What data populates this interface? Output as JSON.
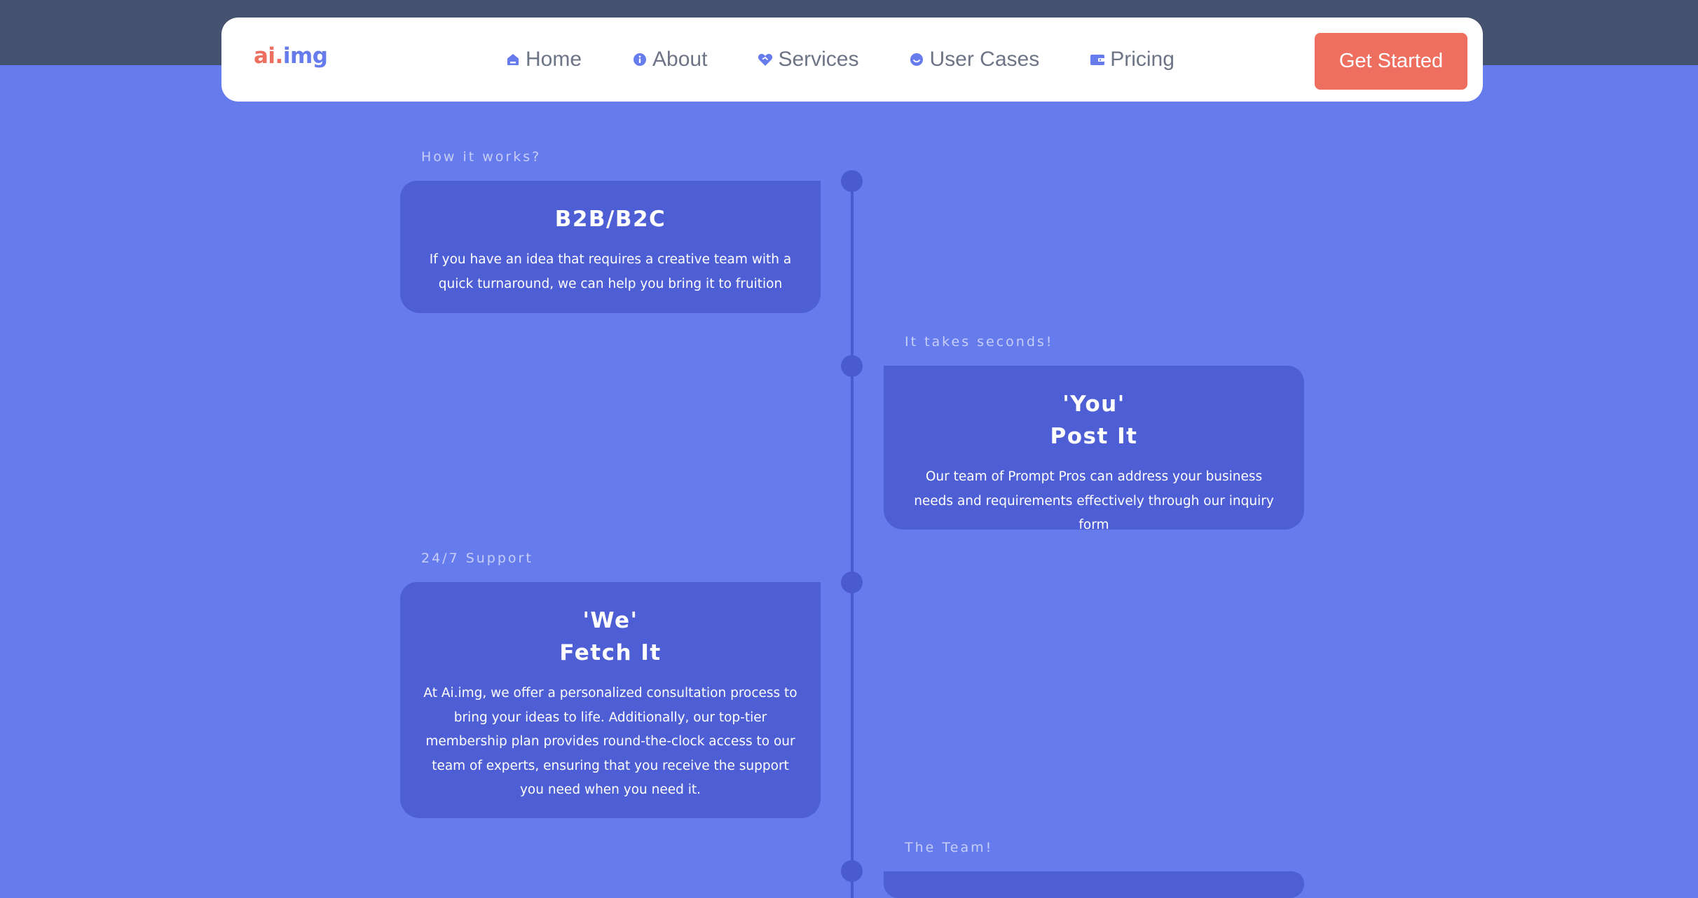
{
  "brand": {
    "part1": "ai",
    "dot": ".",
    "part2": "img"
  },
  "nav": {
    "items": [
      {
        "label": "Home",
        "icon": "home-icon"
      },
      {
        "label": "About",
        "icon": "info-icon"
      },
      {
        "label": "Services",
        "icon": "heart-handshake-icon"
      },
      {
        "label": "User Cases",
        "icon": "smile-icon"
      },
      {
        "label": "Pricing",
        "icon": "wallet-icon"
      }
    ],
    "cta_label": "Get Started"
  },
  "timeline": [
    {
      "label": "How it works?",
      "title_line1": "B2B/B2C",
      "title_line2": "",
      "description": "If you have an idea that requires a creative team with a quick turnaround, we can help you bring it to fruition"
    },
    {
      "label": "It takes seconds!",
      "title_line1": "'You'",
      "title_line2": "Post It",
      "description": "Our team of Prompt Pros can address your business needs and requirements effectively through our inquiry form"
    },
    {
      "label": "24/7 Support",
      "title_line1": "'We'",
      "title_line2": "Fetch It",
      "description": "At Ai.img, we offer a personalized consultation process to bring your ideas to life. Additionally, our top-tier membership plan provides round-the-clock access to our team of experts, ensuring that you receive the support you need when you need it."
    },
    {
      "label": "The Team!",
      "title_line1": "",
      "title_line2": "",
      "description": ""
    }
  ],
  "colors": {
    "page_background": "#667bec",
    "top_band": "#44516f",
    "card": "#4e5ed4",
    "timeline": "#4a5bd1",
    "accent": "#ee6f5f",
    "nav_text": "#6c7485"
  }
}
